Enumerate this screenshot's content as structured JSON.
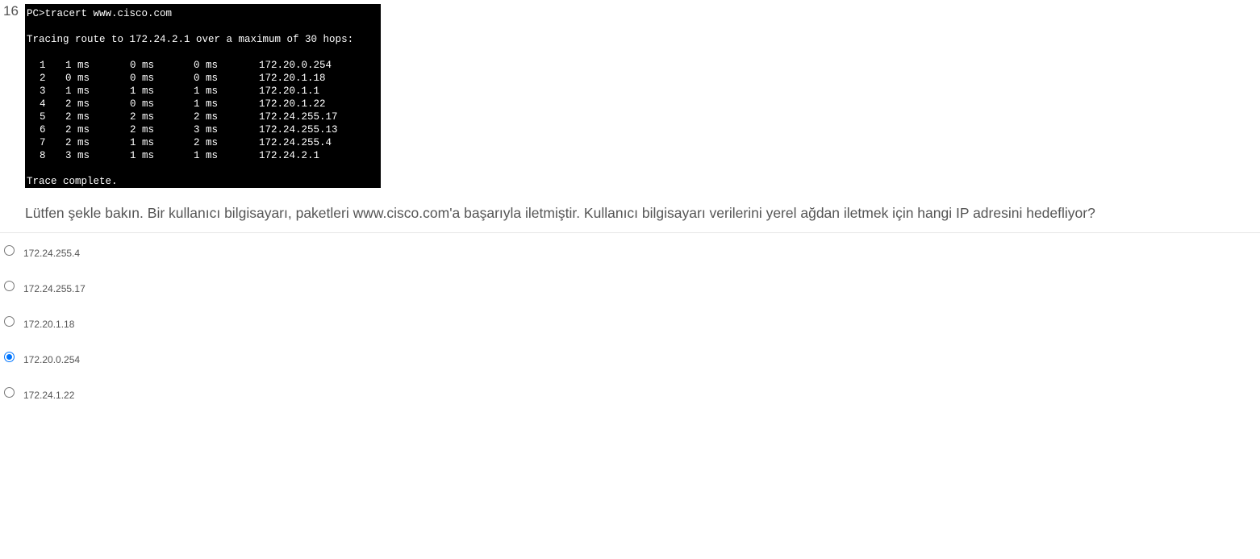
{
  "question": {
    "number": "16",
    "text": "Lütfen şekle bakın. Bir kullanıcı bilgisayarı, paketleri www.cisco.com'a başarıyla iletmiştir. Kullanıcı bilgisayarı verilerini yerel ağdan iletmek için hangi IP adresini hedefliyor?"
  },
  "terminal": {
    "command": "PC>tracert www.cisco.com",
    "header": "Tracing route to 172.24.2.1 over a maximum of 30 hops:",
    "hops": [
      {
        "num": "1",
        "t1": "1 ms",
        "t2": "0 ms",
        "t3": "0 ms",
        "ip": "172.20.0.254"
      },
      {
        "num": "2",
        "t1": "0 ms",
        "t2": "0 ms",
        "t3": "0 ms",
        "ip": "172.20.1.18"
      },
      {
        "num": "3",
        "t1": "1 ms",
        "t2": "1 ms",
        "t3": "1 ms",
        "ip": "172.20.1.1"
      },
      {
        "num": "4",
        "t1": "2 ms",
        "t2": "0 ms",
        "t3": "1 ms",
        "ip": "172.20.1.22"
      },
      {
        "num": "5",
        "t1": "2 ms",
        "t2": "2 ms",
        "t3": "2 ms",
        "ip": "172.24.255.17"
      },
      {
        "num": "6",
        "t1": "2 ms",
        "t2": "2 ms",
        "t3": "3 ms",
        "ip": "172.24.255.13"
      },
      {
        "num": "7",
        "t1": "2 ms",
        "t2": "1 ms",
        "t3": "2 ms",
        "ip": "172.24.255.4"
      },
      {
        "num": "8",
        "t1": "3 ms",
        "t2": "1 ms",
        "t3": "1 ms",
        "ip": "172.24.2.1"
      }
    ],
    "footer": "Trace complete."
  },
  "answers": [
    {
      "label": "172.24.255.4",
      "selected": false
    },
    {
      "label": "172.24.255.17",
      "selected": false
    },
    {
      "label": "172.20.1.18",
      "selected": false
    },
    {
      "label": "172.20.0.254",
      "selected": true
    },
    {
      "label": "172.24.1.22",
      "selected": false
    }
  ],
  "colors": {
    "terminal_bg": "#000000",
    "terminal_fg": "#ffffff",
    "text": "#555555",
    "radio_checked": "#0075ff"
  }
}
